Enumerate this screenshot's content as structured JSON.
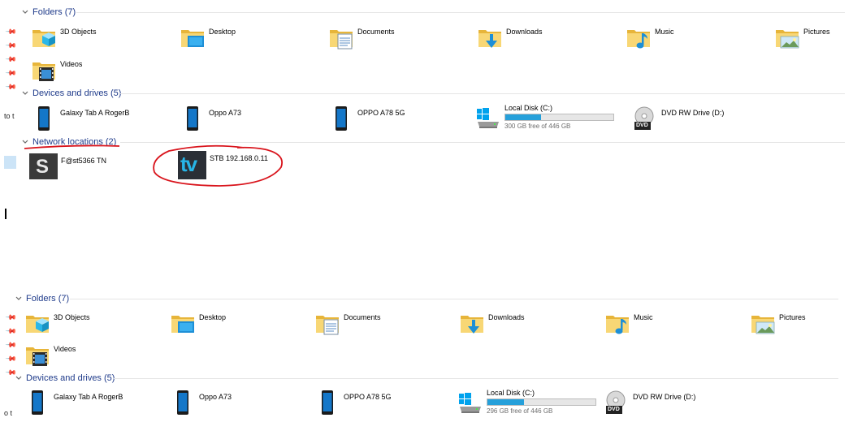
{
  "top": {
    "edge_text": "to t",
    "folders_header": "Folders (7)",
    "folders": [
      {
        "label": "3D Objects",
        "icon": "3d-objects-folder-icon"
      },
      {
        "label": "Desktop",
        "icon": "desktop-folder-icon"
      },
      {
        "label": "Documents",
        "icon": "documents-folder-icon"
      },
      {
        "label": "Downloads",
        "icon": "downloads-folder-icon"
      },
      {
        "label": "Music",
        "icon": "music-folder-icon"
      },
      {
        "label": "Pictures",
        "icon": "pictures-folder-icon"
      },
      {
        "label": "Videos",
        "icon": "videos-folder-icon"
      }
    ],
    "devices_header": "Devices and drives (5)",
    "devices": [
      {
        "label": "Galaxy Tab A RogerB",
        "icon": "tablet-device-icon"
      },
      {
        "label": "Oppo A73",
        "icon": "phone-device-icon"
      },
      {
        "label": "OPPO A78 5G",
        "icon": "phone-device-icon"
      }
    ],
    "local_disk": {
      "name": "Local Disk (C:)",
      "free": "300 GB free of 446 GB",
      "used_fraction": 0.33
    },
    "dvd": {
      "label": "DVD RW Drive (D:)",
      "badge": "DVD"
    },
    "network_header": "Network locations (2)",
    "network": [
      {
        "label": "F@st5366 TN",
        "icon": "sagemcom-router-icon",
        "glyph": "S"
      },
      {
        "label": "STB 192.168.0.11",
        "icon": "tv-stb-icon",
        "glyph": "tv"
      }
    ],
    "annotation_color": "#d9141c"
  },
  "bottom": {
    "edge_text": "o t",
    "folders_header": "Folders (7)",
    "folders": [
      {
        "label": "3D Objects"
      },
      {
        "label": "Desktop"
      },
      {
        "label": "Documents"
      },
      {
        "label": "Downloads"
      },
      {
        "label": "Music"
      },
      {
        "label": "Pictures"
      },
      {
        "label": "Videos"
      }
    ],
    "devices_header": "Devices and drives (5)",
    "devices": [
      {
        "label": "Galaxy Tab A RogerB"
      },
      {
        "label": "Oppo A73"
      },
      {
        "label": "OPPO A78 5G"
      }
    ],
    "local_disk": {
      "name": "Local Disk (C:)",
      "free": "296 GB free of 446 GB",
      "used_fraction": 0.34
    },
    "dvd": {
      "label": "DVD RW Drive (D:)",
      "badge": "DVD"
    }
  },
  "colors": {
    "header_text": "#1e3a8a",
    "folder_yellow": "#f6c342",
    "drive_fill": "#26a0da",
    "win_blue": "#00a2ed"
  }
}
